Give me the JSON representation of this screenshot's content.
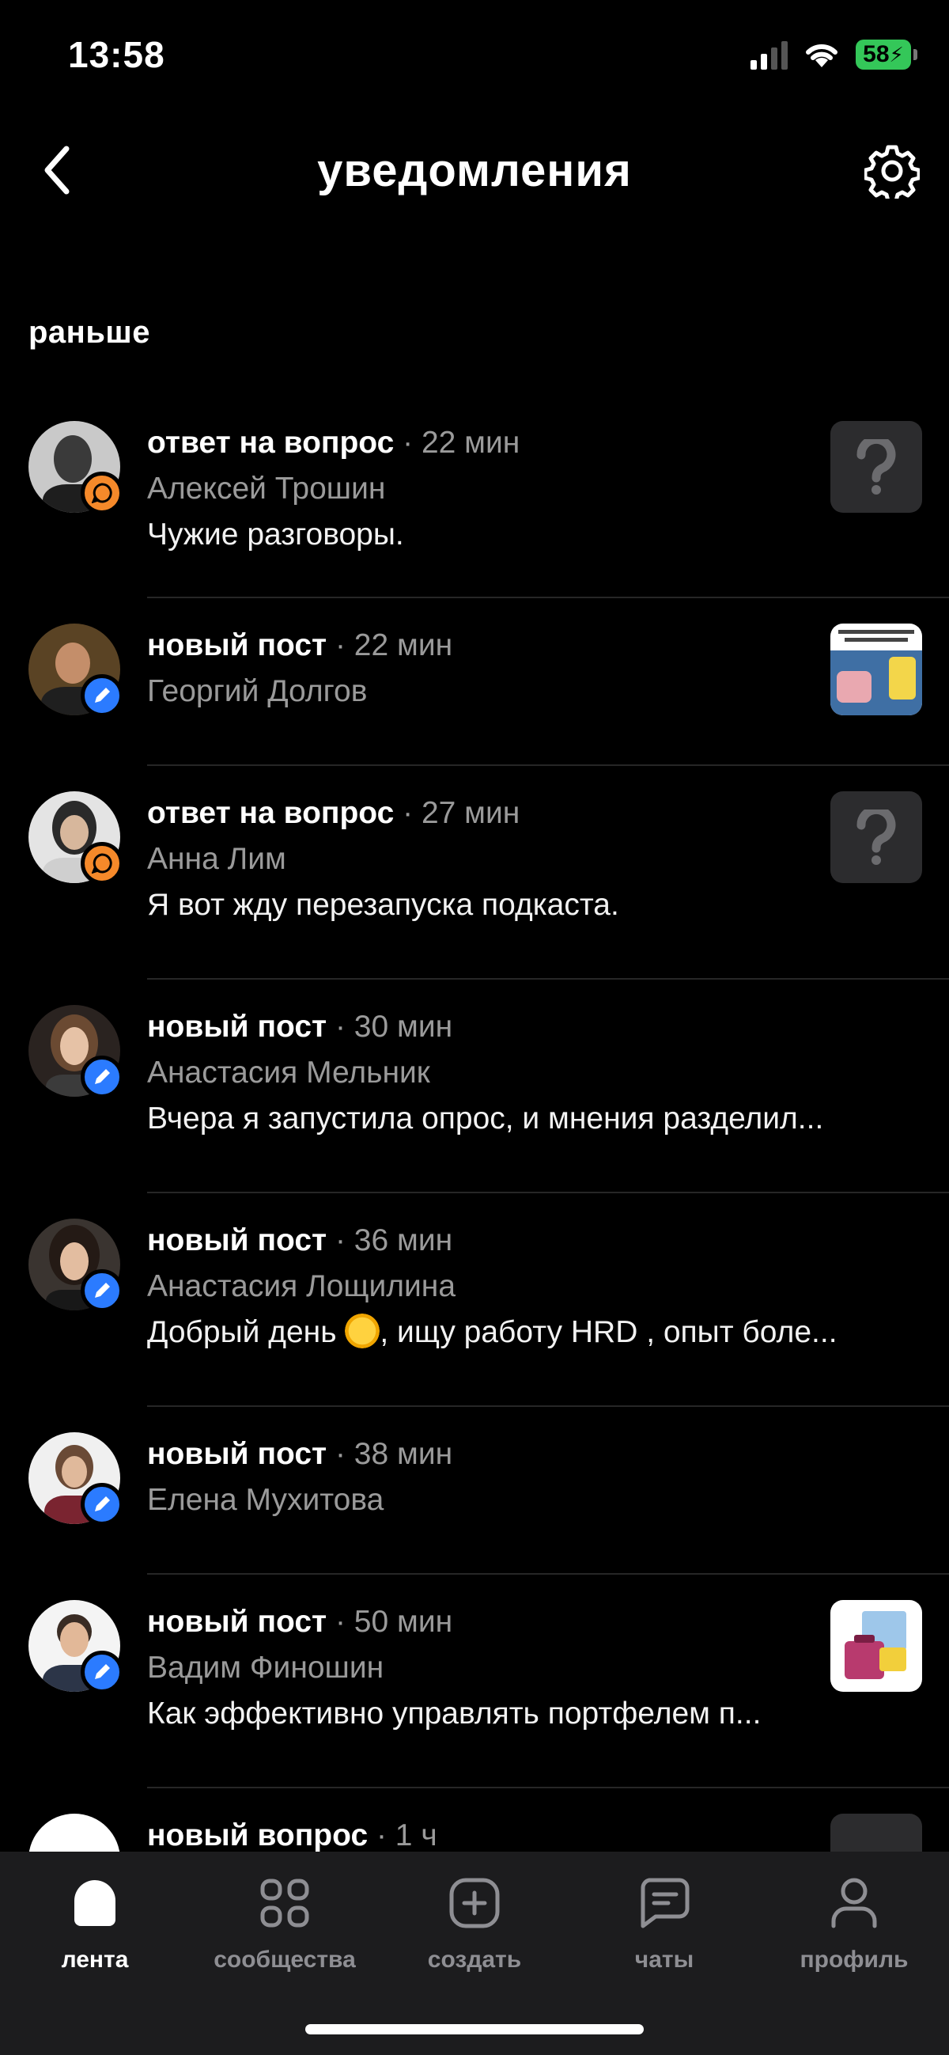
{
  "status_bar": {
    "time": "13:58",
    "battery": "58"
  },
  "header": {
    "title": "уведомления"
  },
  "section": {
    "label": "раньше"
  },
  "notifications": [
    {
      "type": "ответ на вопрос",
      "time": "· 22 мин",
      "author": "Алексей Трошин",
      "text": "Чужие разговоры."
    },
    {
      "type": "новый пост",
      "time": "· 22 мин",
      "author": "Георгий Долгов",
      "text": ""
    },
    {
      "type": "ответ на вопрос",
      "time": "· 27 мин",
      "author": "Анна Лим",
      "text": "Я вот жду перезапуска подкаста."
    },
    {
      "type": "новый пост",
      "time": "· 30 мин",
      "author": "Анастасия Мельник",
      "text": "Вчера я запустила опрос, и мнения разделил..."
    },
    {
      "type": "новый пост",
      "time": "· 36 мин",
      "author": "Анастасия Лощилина",
      "text_before": "Добрый день ",
      "text_after": ", ищу работу HRD , опыт боле..."
    },
    {
      "type": "новый пост",
      "time": "· 38 мин",
      "author": "Елена Мухитова",
      "text": ""
    },
    {
      "type": "новый пост",
      "time": "· 50 мин",
      "author": "Вадим Финошин",
      "text": "Как эффективно управлять портфелем п..."
    },
    {
      "type": "новый вопрос",
      "time": "· 1 ч",
      "author": "",
      "text": ""
    }
  ],
  "tabs": [
    {
      "label": "лента",
      "icon": "feed-icon",
      "active": true
    },
    {
      "label": "сообщества",
      "icon": "communities-icon",
      "active": false
    },
    {
      "label": "создать",
      "icon": "create-icon",
      "active": false
    },
    {
      "label": "чаты",
      "icon": "chats-icon",
      "active": false
    },
    {
      "label": "профиль",
      "icon": "profile-icon",
      "active": false
    }
  ],
  "colors": {
    "badge_answer": "#f5892a",
    "badge_post": "#2b7bff",
    "battery": "#34c759",
    "tab_bar": "#1c1c1e"
  }
}
